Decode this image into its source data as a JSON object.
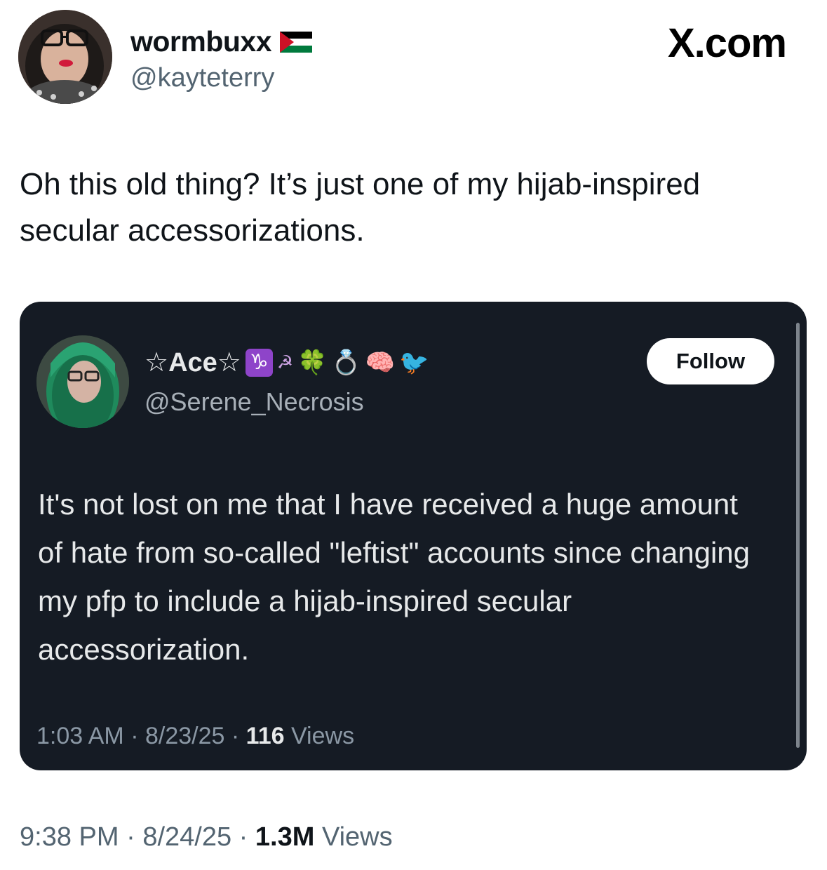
{
  "brand": "X.com",
  "tweet": {
    "display_name": "wormbuxx",
    "handle": "@kayteterry",
    "text": "Oh this old thing? It’s just one of my hijab-inspired secular accessorizations.",
    "time": "9:38 PM",
    "date": "8/24/25",
    "sep": "·",
    "views_count": "1.3M",
    "views_label": "Views"
  },
  "quoted": {
    "display_name_prefix": "☆Ace☆",
    "name_emoji": [
      "♑",
      "☭",
      "🍀",
      "💍",
      "🧠",
      "🐦"
    ],
    "handle": "@Serene_Necrosis",
    "follow_label": "Follow",
    "text": "It's not lost on me that I have received a huge amount of hate from so-called \"leftist\" accounts since changing my pfp to include a hijab-inspired secular accessorization.",
    "time": "1:03 AM",
    "date": "8/23/25",
    "sep": "·",
    "views_count": "116",
    "views_label": "Views"
  },
  "icons": {
    "flag": "palestine-flag-icon",
    "capricorn": "capricorn-icon",
    "hammer_sickle": "hammer-sickle-icon",
    "clover": "clover-icon",
    "ring": "ring-icon",
    "brain": "brain-icon",
    "bird": "bird-icon"
  },
  "colors": {
    "quote_bg": "#151b24",
    "muted_text": "#536471",
    "flag_red": "#ce1126",
    "flag_green": "#007a3d"
  }
}
